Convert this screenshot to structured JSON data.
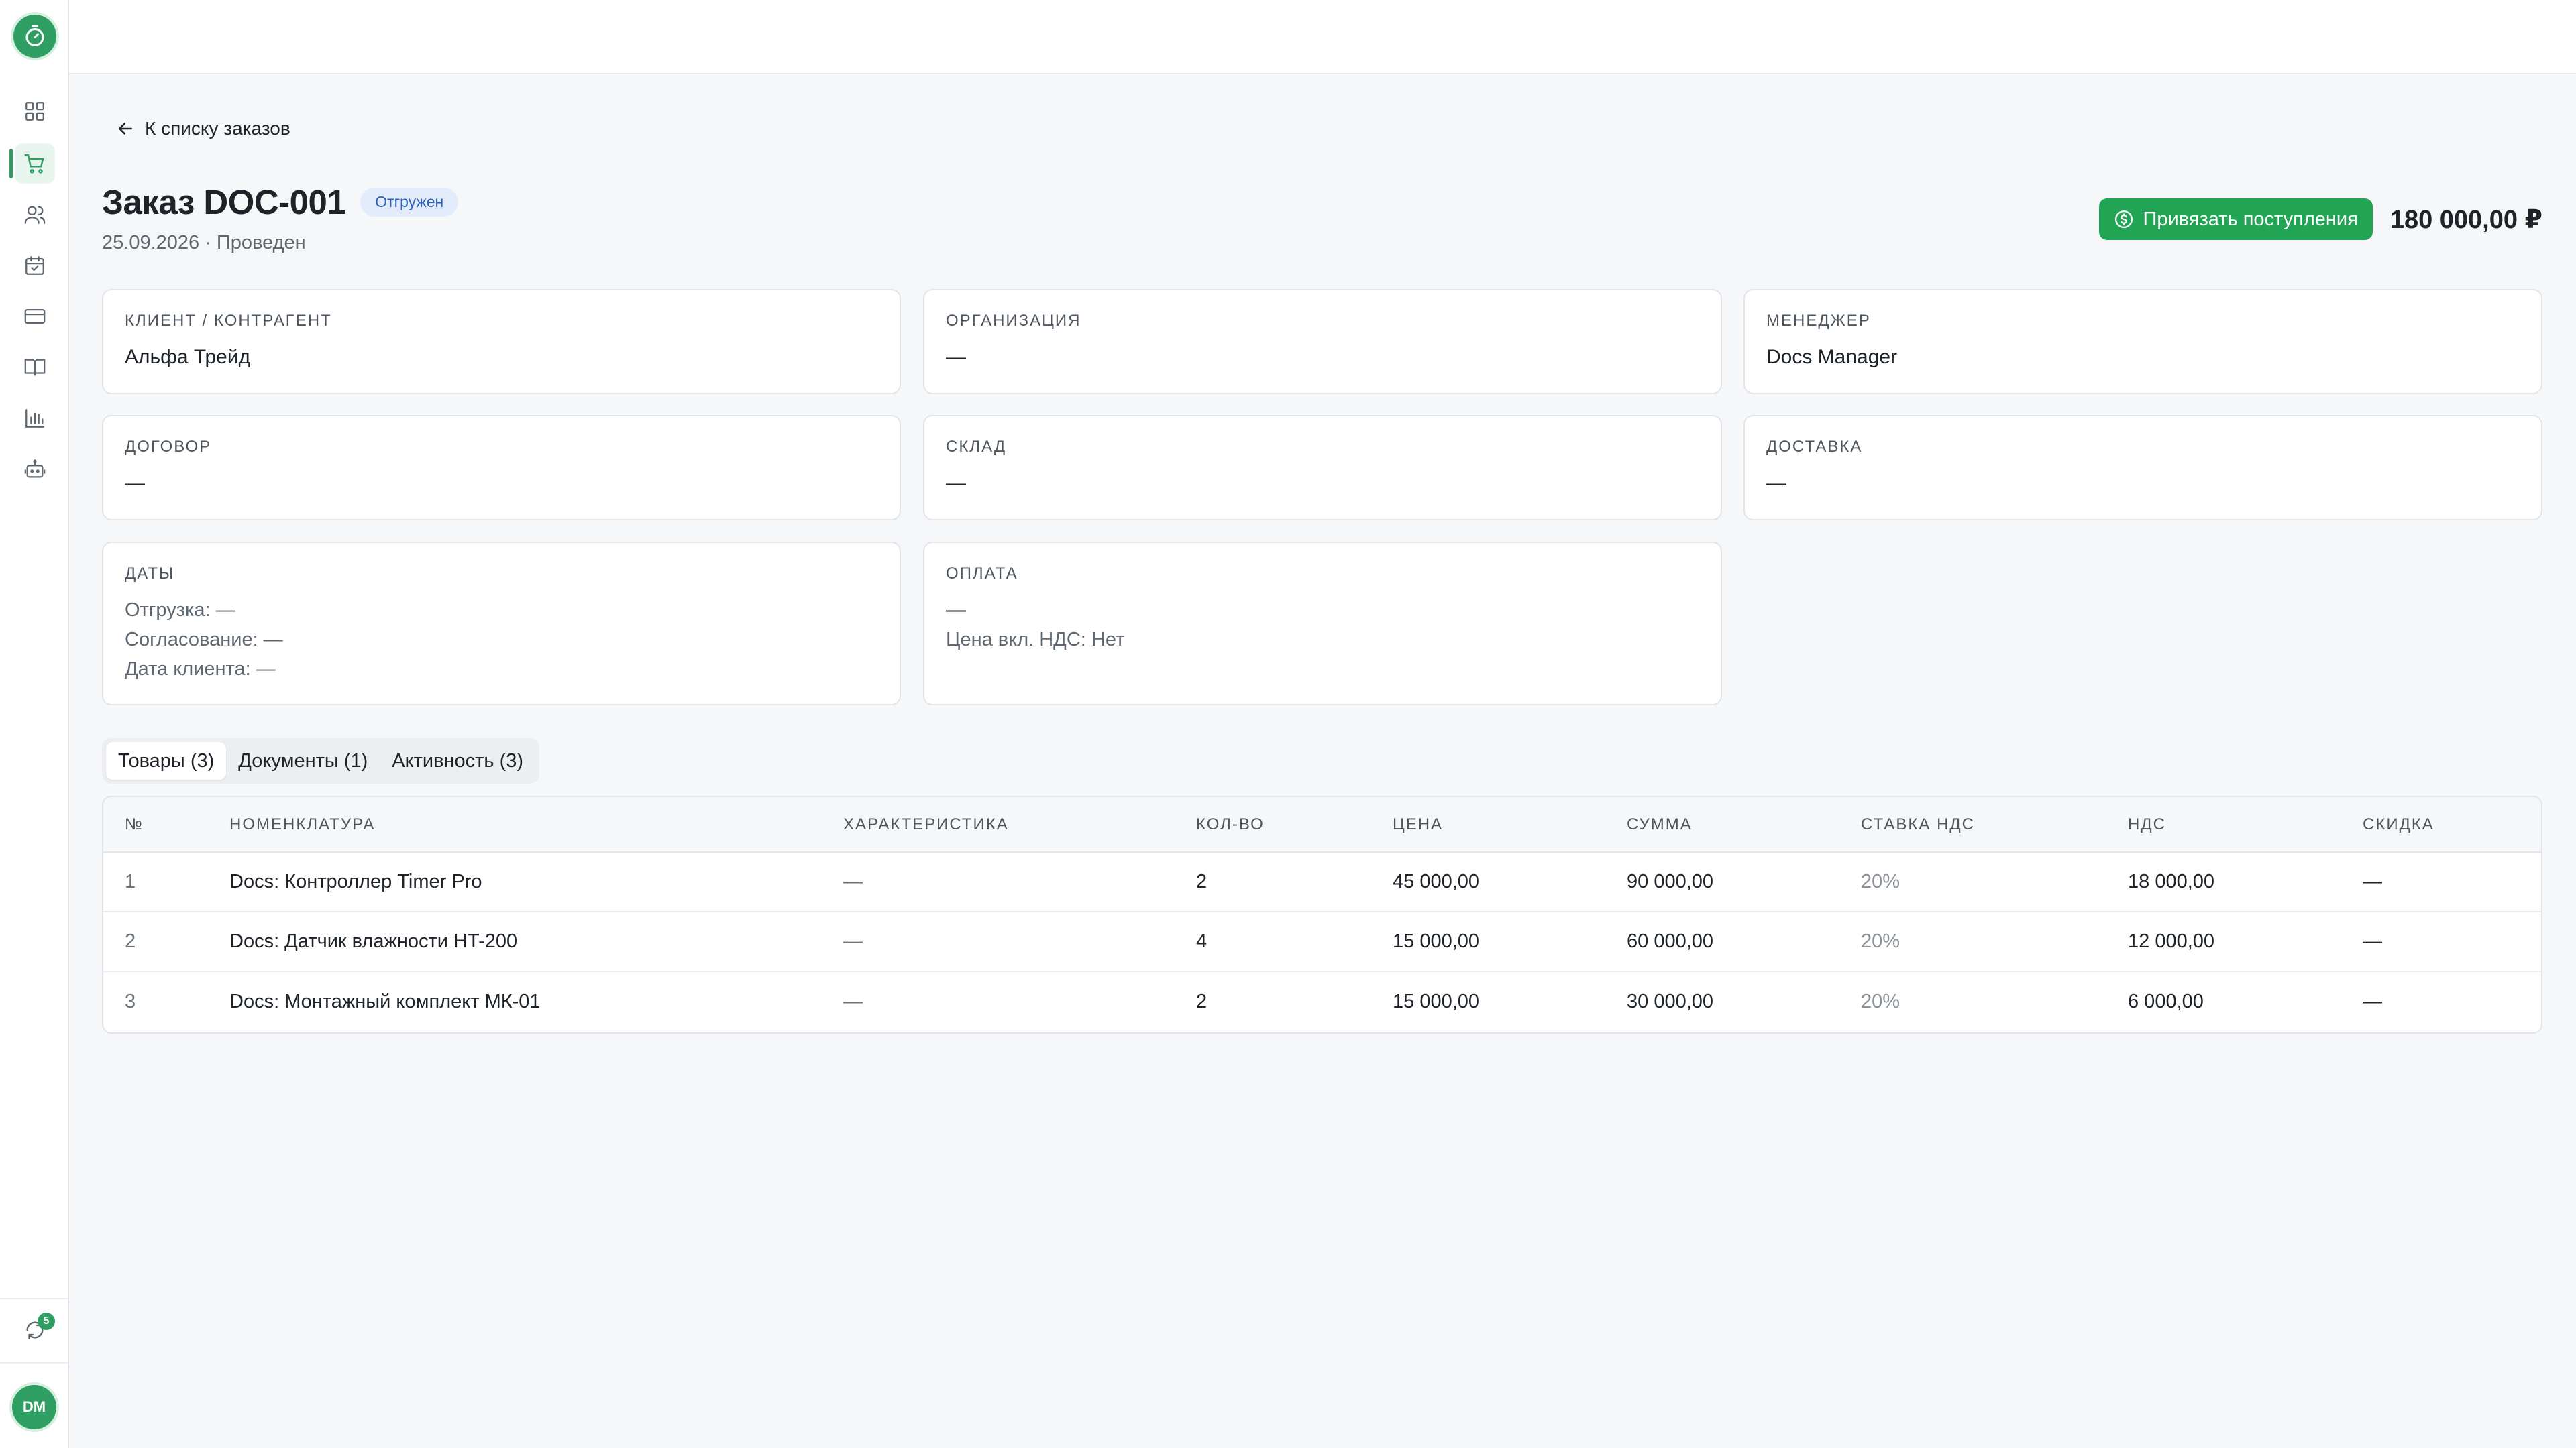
{
  "sidebar": {
    "logo_icon": "timer-icon",
    "items": [
      {
        "name": "dashboard",
        "icon": "grid-icon",
        "active": false
      },
      {
        "name": "orders",
        "icon": "cart-icon",
        "active": true
      },
      {
        "name": "contacts",
        "icon": "users-icon",
        "active": false
      },
      {
        "name": "calendar",
        "icon": "calendar-check-icon",
        "active": false
      },
      {
        "name": "payments",
        "icon": "card-icon",
        "active": false
      },
      {
        "name": "catalog",
        "icon": "book-icon",
        "active": false
      },
      {
        "name": "reports",
        "icon": "bar-chart-icon",
        "active": false
      },
      {
        "name": "bot",
        "icon": "bot-icon",
        "active": false
      }
    ],
    "sync_count": "5",
    "avatar_initials": "DM"
  },
  "header": {
    "back_label": "К списку заказов",
    "title": "Заказ DOC-001",
    "status": "Отгружен",
    "subtitle": "25.09.2026 · Проведен",
    "action_label": "Привязать поступления",
    "total": "180 000,00 ₽"
  },
  "cards": {
    "client": {
      "label": "КЛИЕНТ / КОНТРАГЕНТ",
      "value": "Альфа Трейд"
    },
    "organization": {
      "label": "ОРГАНИЗАЦИЯ",
      "value": "—"
    },
    "manager": {
      "label": "МЕНЕДЖЕР",
      "value": "Docs Manager"
    },
    "contract": {
      "label": "ДОГОВОР",
      "value": "—"
    },
    "warehouse": {
      "label": "СКЛАД",
      "value": "—"
    },
    "delivery": {
      "label": "ДОСТАВКА",
      "value": "—"
    },
    "dates": {
      "label": "ДАТЫ",
      "lines": [
        "Отгрузка: —",
        "Согласование: —",
        "Дата клиента: —"
      ]
    },
    "payment": {
      "label": "ОПЛАТА",
      "value": "—",
      "vat_line": "Цена вкл. НДС: Нет"
    }
  },
  "tabs": [
    {
      "label": "Товары (3)",
      "active": true
    },
    {
      "label": "Документы (1)",
      "active": false
    },
    {
      "label": "Активность (3)",
      "active": false
    }
  ],
  "table": {
    "columns": [
      "№",
      "НОМЕНКЛАТУРА",
      "ХАРАКТЕРИСТИКА",
      "КОЛ-ВО",
      "ЦЕНА",
      "СУММА",
      "СТАВКА НДС",
      "НДС",
      "СКИДКА"
    ],
    "rows": [
      [
        "1",
        "Docs: Контроллер Timer Pro",
        "—",
        "2",
        "45 000,00",
        "90 000,00",
        "20%",
        "18 000,00",
        "—"
      ],
      [
        "2",
        "Docs: Датчик влажности HT-200",
        "—",
        "4",
        "15 000,00",
        "60 000,00",
        "20%",
        "12 000,00",
        "—"
      ],
      [
        "3",
        "Docs: Монтажный комплект МК-01",
        "—",
        "2",
        "15 000,00",
        "30 000,00",
        "20%",
        "6 000,00",
        "—"
      ]
    ]
  },
  "colors": {
    "accent": "#21a454",
    "badge_bg": "#e3ecfb",
    "badge_text": "#2c5fb7"
  }
}
